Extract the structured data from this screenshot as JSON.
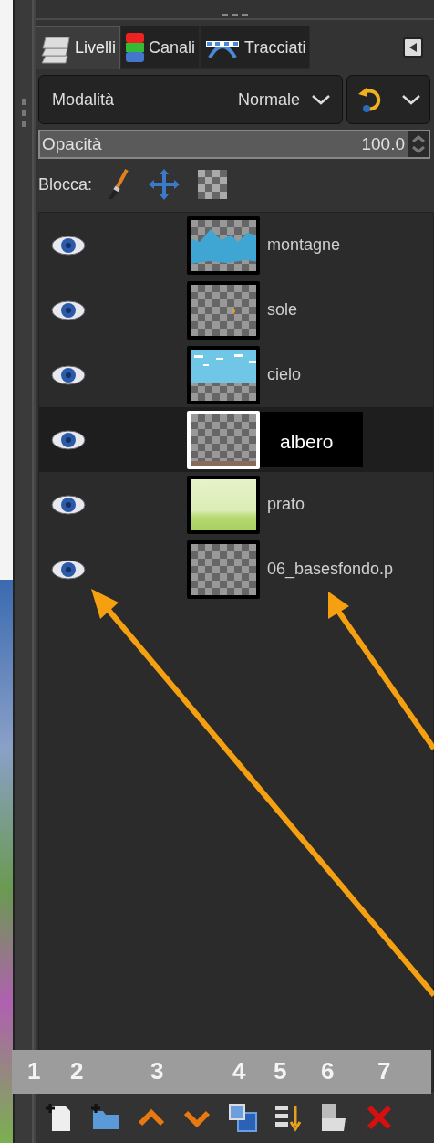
{
  "tabs": [
    {
      "label": "Livelli",
      "selected": true
    },
    {
      "label": "Canali",
      "selected": false
    },
    {
      "label": "Tracciati",
      "selected": false
    }
  ],
  "mode": {
    "label": "Modalità",
    "value": "Normale"
  },
  "opacity": {
    "label": "Opacità",
    "value": "100.0",
    "level": 1
  },
  "lock": {
    "label": "Blocca:"
  },
  "layers": [
    {
      "name": "montagne",
      "visible": true,
      "selected": false,
      "kind": "mountains"
    },
    {
      "name": "sole",
      "visible": true,
      "selected": false,
      "kind": "sun"
    },
    {
      "name": "cielo",
      "visible": true,
      "selected": false,
      "kind": "sky"
    },
    {
      "name": "albero",
      "visible": true,
      "selected": true,
      "kind": "ground"
    },
    {
      "name": "prato",
      "visible": true,
      "selected": false,
      "kind": "meadow"
    },
    {
      "name": "06_basesfondo.p",
      "visible": true,
      "selected": false,
      "kind": "empty"
    }
  ],
  "annotation_numbers": [
    "1",
    "2",
    "3",
    "4",
    "5",
    "6",
    "7"
  ]
}
